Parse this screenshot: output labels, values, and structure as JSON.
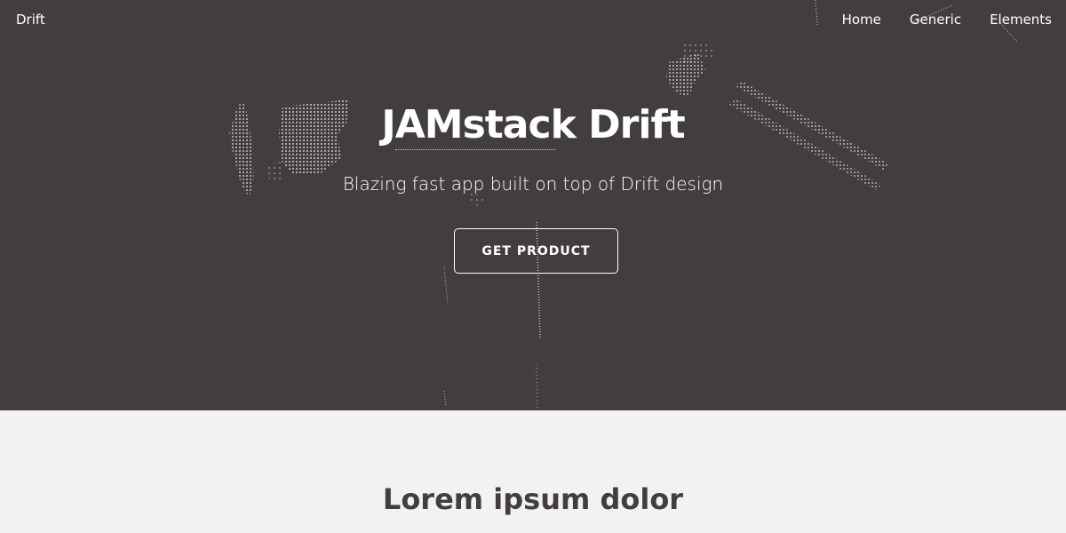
{
  "header": {
    "brand": "Drift",
    "nav": [
      "Home",
      "Generic",
      "Elements"
    ]
  },
  "hero": {
    "title": "JAMstack Drift",
    "subtitle": "Blazing fast app built on top of Drift design",
    "cta_label": "GET PRODUCT"
  },
  "main": {
    "section_title": "Lorem ipsum dolor"
  },
  "colors": {
    "hero_background": "#433e3e",
    "page_background": "#f2f2f2",
    "text_light": "#ffffff",
    "text_dark": "#433e3e"
  }
}
